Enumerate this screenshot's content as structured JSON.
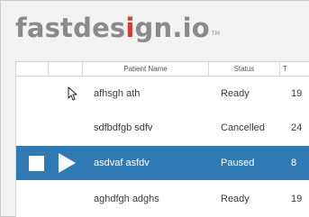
{
  "logo": {
    "part1": "fastdes",
    "accent": "i",
    "part2": "gn.io",
    "tm": "TM"
  },
  "grid": {
    "columns": [
      {
        "label": ""
      },
      {
        "label": ""
      },
      {
        "label": "Patient Name"
      },
      {
        "label": "Status"
      },
      {
        "label": "T"
      }
    ],
    "rows": [
      {
        "name": "afhsgh ath",
        "status": "Ready",
        "num": "19",
        "selected": false
      },
      {
        "name": "sdfbdfgb sdfv",
        "status": "Cancelled",
        "num": "24",
        "selected": false
      },
      {
        "name": "asdvaf asfdv",
        "status": "Paused",
        "num": "8",
        "selected": true
      },
      {
        "name": "aghdfgh adghs",
        "status": "Ready",
        "num": "19",
        "selected": false
      }
    ]
  },
  "icons": {
    "stop": "stop-icon",
    "play": "play-icon",
    "cursor": "mouse-cursor-icon"
  },
  "colors": {
    "selected_row": "#2f7ab5",
    "logo_grey": "#8a8a8a",
    "logo_accent": "#d93a2c"
  }
}
